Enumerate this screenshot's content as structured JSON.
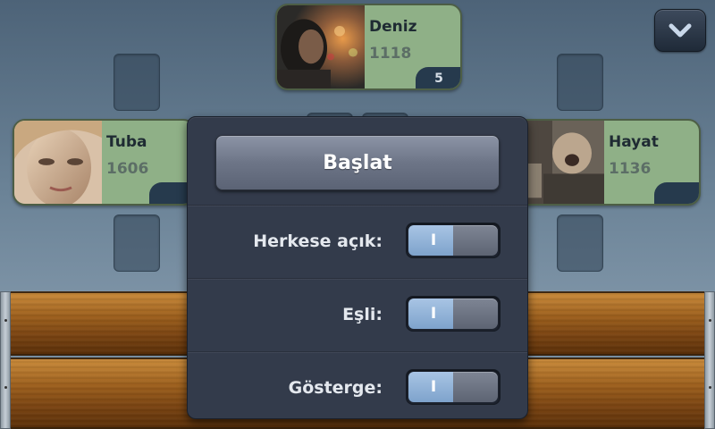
{
  "players": {
    "top": {
      "name": "Deniz",
      "score": "1118",
      "badge": "5"
    },
    "left": {
      "name": "Tuba",
      "score": "1606",
      "badge": ""
    },
    "right": {
      "name": "Hayat",
      "score": "1136",
      "badge": ""
    }
  },
  "panel": {
    "start_label": "Başlat",
    "options": [
      {
        "label": "Herkese açık:",
        "toggle_text": "I",
        "state": "on"
      },
      {
        "label": "Eşli:",
        "toggle_text": "I",
        "state": "on"
      },
      {
        "label": "Gösterge:",
        "toggle_text": "I",
        "state": "on"
      }
    ]
  },
  "icons": {
    "dropdown": "chevron-down-icon"
  },
  "colors": {
    "card_green": "#8fb087",
    "toggle_on": "#7ea3cc",
    "panel_bg": "#333b4b"
  }
}
